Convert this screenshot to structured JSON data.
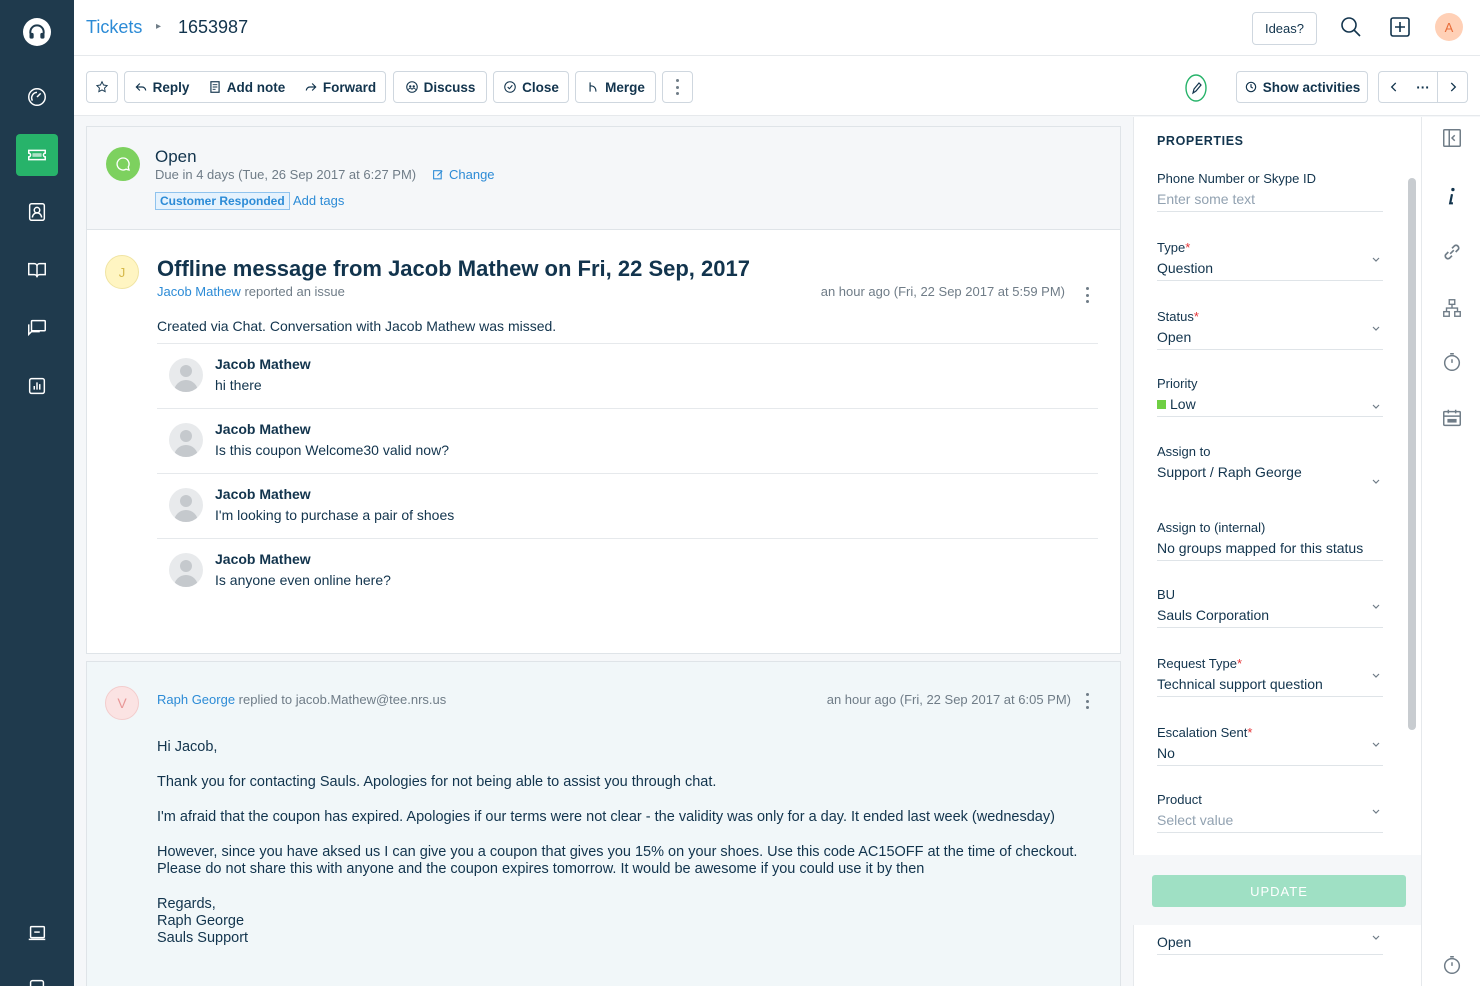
{
  "nav": {
    "items": [
      "dashboard",
      "tickets",
      "contacts",
      "solutions",
      "forums",
      "reports"
    ],
    "active": "tickets"
  },
  "header": {
    "breadcrumb_root": "Tickets",
    "breadcrumb_sep": "▸",
    "ticket_id": "1653987",
    "ideas_label": "Ideas?",
    "avatar_initial": "A"
  },
  "toolbar": {
    "reply": "Reply",
    "add_note": "Add note",
    "forward": "Forward",
    "discuss": "Discuss",
    "close": "Close",
    "merge": "Merge",
    "show_activities": "Show activities",
    "pager_more": "···"
  },
  "status": {
    "title": "Open",
    "due": "Due in 4 days (Tue, 26 Sep 2017 at 6:27 PM)",
    "change_label": "Change",
    "tag": "Customer Responded",
    "add_tags": "Add tags"
  },
  "message": {
    "avatar_initial": "J",
    "title": "Offline message from Jacob Mathew on Fri, 22 Sep, 2017",
    "author": "Jacob Mathew",
    "action": " reported an issue",
    "time": "an hour ago (Fri, 22 Sep 2017 at 5:59 PM)",
    "description": "Created via Chat. Conversation with Jacob Mathew was missed.",
    "chats": [
      {
        "name": "Jacob Mathew",
        "text": "hi there"
      },
      {
        "name": "Jacob Mathew",
        "text": "Is this coupon Welcome30 valid now?"
      },
      {
        "name": "Jacob Mathew",
        "text": "I'm looking to purchase a pair of shoes"
      },
      {
        "name": "Jacob Mathew",
        "text": "Is anyone even online here?"
      }
    ]
  },
  "reply": {
    "avatar_initial": "V",
    "author": "Raph George",
    "action": " replied to ",
    "recipient": "jacob.Mathew@tee.nrs.us",
    "time": "an hour ago (Fri, 22 Sep 2017 at 6:05 PM)",
    "greeting": "Hi Jacob,",
    "p1": "Thank you for contacting Sauls. Apologies for not being able to assist you through chat.",
    "p2": "I'm afraid that the coupon has expired. Apologies if our terms were not clear - the validity was only for a day. It ended last week (wednesday)",
    "p3": "However, since you have aksed us I can give you a coupon that gives you 15% on your shoes. Use this code AC15OFF at the time of checkout. Please do not share this with anyone and the coupon expires tomorrow. It would be awesome if you could use it by then",
    "sign1": "Regards,",
    "sign2": "Raph George",
    "sign3": "Sauls Support"
  },
  "properties": {
    "title": "PROPERTIES",
    "phone_label": "Phone Number or Skype ID",
    "phone_placeholder": "Enter some text",
    "type_label": "Type",
    "type_value": "Question",
    "status_label": "Status",
    "status_value": "Open",
    "priority_label": "Priority",
    "priority_value": "Low",
    "priority_color": "#6fcf43",
    "assign_label": "Assign to",
    "assign_value": "Support / Raph George",
    "assign_internal_label": "Assign to (internal)",
    "assign_internal_value": "No groups mapped for this status",
    "bu_label": "BU",
    "bu_value": "Sauls Corporation",
    "request_type_label": "Request Type",
    "request_type_value": "Technical support question",
    "escalation_label": "Escalation Sent",
    "escalation_value": "No",
    "product_label": "Product",
    "product_placeholder": "Select value",
    "update_label": "UPDATE",
    "status2_value": "Open",
    "required_mark": "*"
  },
  "colors": {
    "nav_bg": "#1f3a4d",
    "accent_green": "#27b36a",
    "link_blue": "#2c8bd6"
  }
}
